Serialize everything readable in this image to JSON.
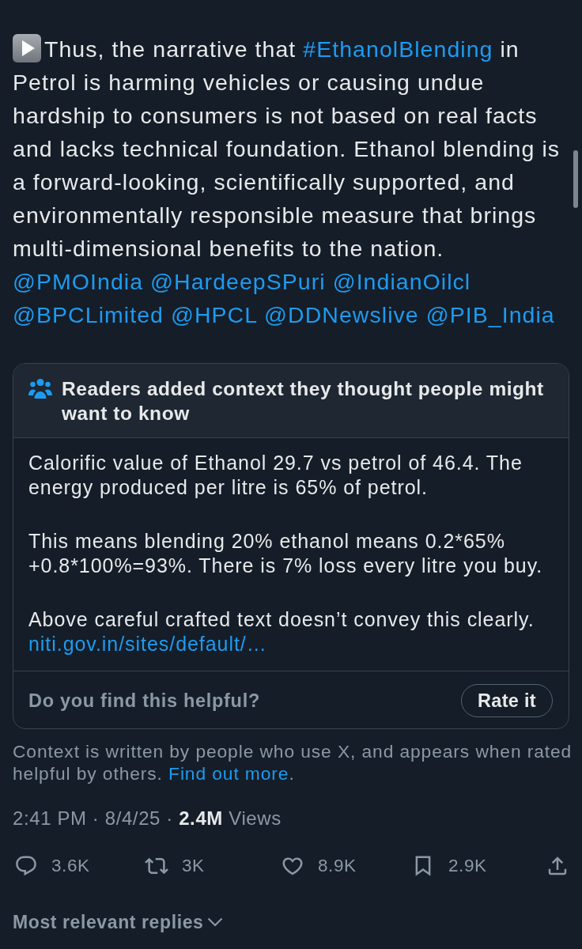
{
  "tweet": {
    "segments": [
      {
        "kind": "text",
        "text": "Thus, the narrative that "
      },
      {
        "kind": "hashtag",
        "text": "#EthanolBlending"
      },
      {
        "kind": "text",
        "text": " in Petrol is harming vehicles or causing undue hardship to consumers is not based on real facts and lacks technical foundation. Ethanol blending is a forward-looking, scientifically supported, and environmentally responsible measure that brings multi-dimensional benefits to the nation."
      }
    ],
    "mentions": [
      "@PMOIndia",
      "@HardeepSPuri",
      "@IndianOilcl",
      "@BPCLimited",
      "@HPCL",
      "@DDNewslive",
      "@PIB_India"
    ]
  },
  "community_note": {
    "title": "Readers added context they thought people might want to know",
    "paragraphs": [
      {
        "text": "Calorific value of Ethanol 29.7 vs petrol of 46.4. The energy produced per litre is 65% of petrol."
      },
      {
        "text": "This means blending 20% ethanol means 0.2*65% +0.8*100%=93%. There is 7% loss every litre you buy."
      },
      {
        "text": "Above careful crafted text doesn’t convey this clearly.",
        "link": "niti.gov.in/sites/default/…"
      }
    ],
    "prompt": "Do you find this helpful?",
    "button": "Rate it"
  },
  "note_disclaimer": {
    "text": "Context is written by people who use X, and appears when rated helpful by others.",
    "link": "Find out more",
    "link_suffix": "."
  },
  "meta": {
    "line": "2:41 PM · 8/4/25 · **2.4M** Views"
  },
  "actions": [
    {
      "kind": "reply",
      "count": "3.6K"
    },
    {
      "kind": "repost",
      "count": "3K"
    },
    {
      "kind": "like",
      "count": "8.9K"
    },
    {
      "kind": "bookmark",
      "count": "2.9K"
    },
    {
      "kind": "share"
    }
  ],
  "replies_sort": {
    "label": "Most relevant replies"
  }
}
